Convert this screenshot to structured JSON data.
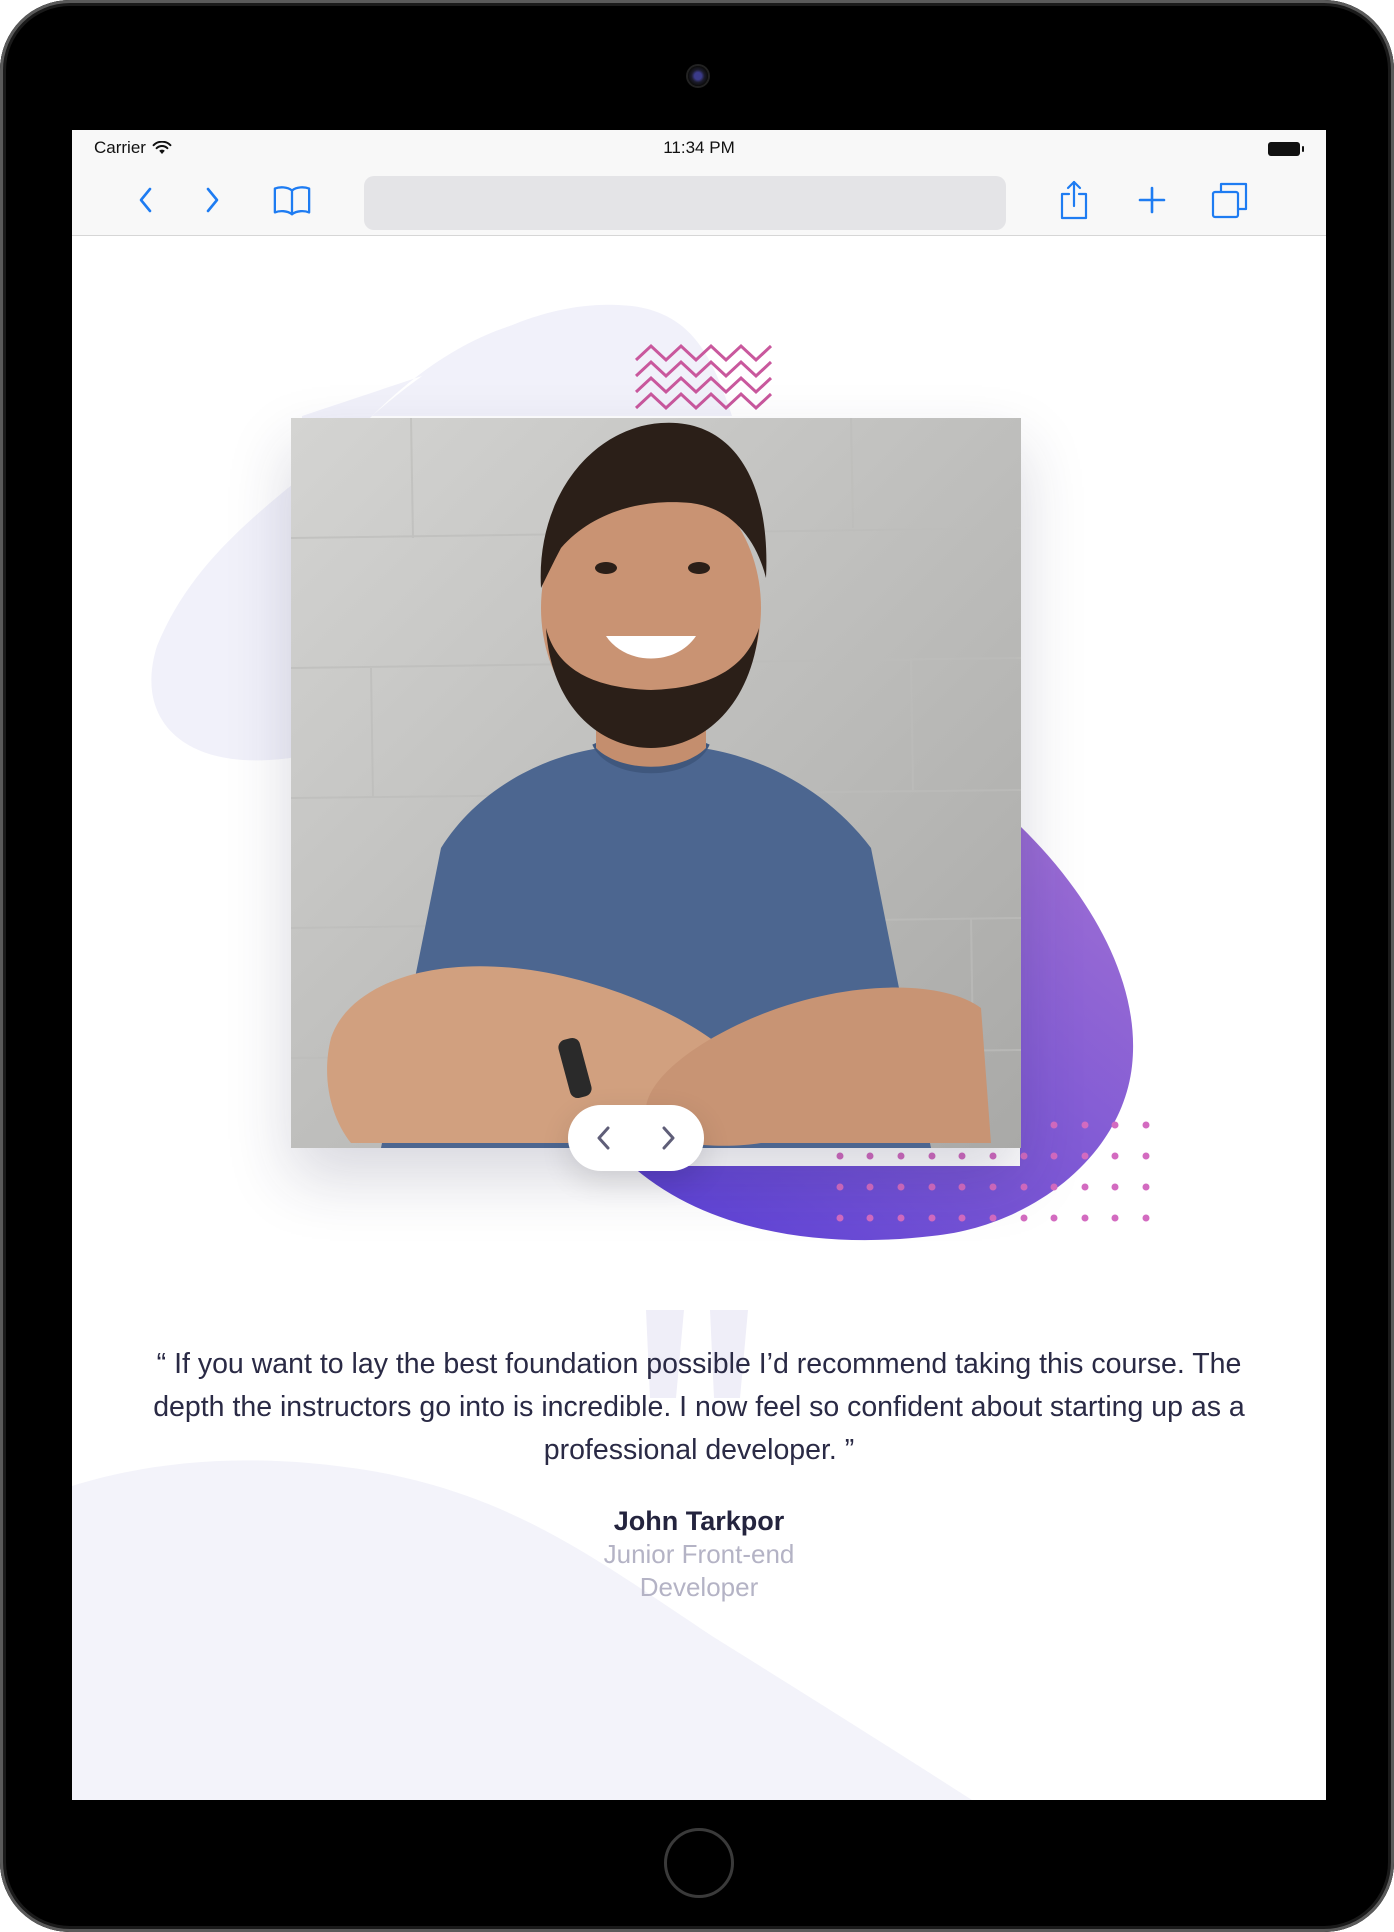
{
  "status_bar": {
    "carrier": "Carrier",
    "time": "11:34 PM"
  },
  "browser": {
    "address_placeholder": ""
  },
  "slider": {
    "prev_label": "previous testimonial",
    "next_label": "next testimonial"
  },
  "testimonial": {
    "quote": "“ If you want to lay the best foundation possible I’d recommend taking this course. The depth the instructors go into is incredible. I now feel so confident about starting up as a professional developer. ”",
    "author_name": "John Tarkpor",
    "author_role": "Junior Front-end Developer"
  },
  "colors": {
    "accent_blue": "#1e7cf2",
    "zigzag_pink": "#c9589d",
    "dot_pink": "#d36bc0",
    "blob_purple_start": "#a070d4",
    "blob_purple_end": "#5a40d6",
    "blob_light": "#f1f1fa",
    "text_dark": "#2a2a45",
    "text_muted": "#b4b3c5"
  },
  "icons": [
    "wifi-icon",
    "battery-icon",
    "back-icon",
    "forward-icon",
    "bookmarks-icon",
    "share-icon",
    "add-icon",
    "tabs-icon",
    "chevron-left-icon",
    "chevron-right-icon",
    "quote-icon"
  ]
}
